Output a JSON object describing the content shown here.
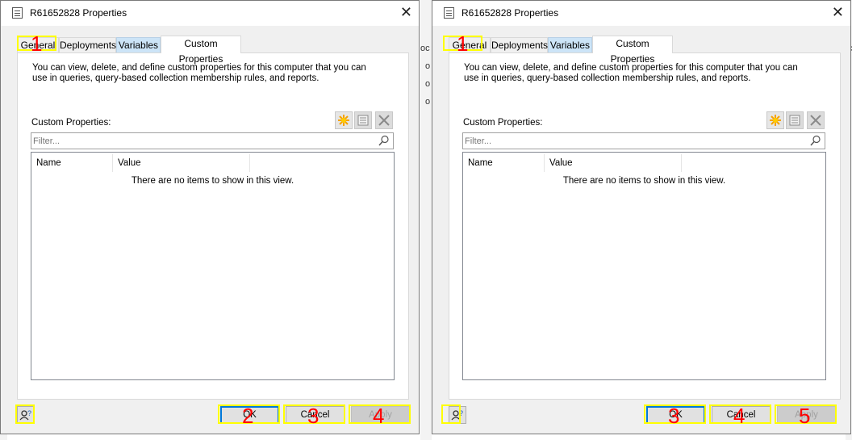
{
  "colors": {
    "annotation_box": "#ffff00",
    "annotation_number": "#ff0000",
    "tab_highlight": "#cce4f7",
    "default_button_border": "#0078d7"
  },
  "background": {
    "left_fragments": [
      "o",
      "o",
      "o"
    ],
    "mid_fragments": [
      "oc",
      "o",
      "o",
      "o"
    ],
    "right_fragments": [
      "oc",
      "o",
      "o"
    ]
  },
  "dialogs": [
    {
      "title": "R61652828 Properties",
      "close_glyph": "✕",
      "tabs": [
        "General",
        "Deployments",
        "Variables",
        "Custom Properties"
      ],
      "active_tab": "Custom Properties",
      "description": "You can view, delete, and define custom properties for this computer that you can use in queries, query-based collection membership rules, and reports.",
      "custom_properties_label": "Custom Properties:",
      "toolbar_icons": [
        "new-star-icon",
        "properties-icon",
        "delete-icon"
      ],
      "filter_placeholder": "Filter...",
      "columns": [
        "Name",
        "Value"
      ],
      "empty_message": "There are no items to show in this view.",
      "buttons": {
        "ok": "OK",
        "cancel": "Cancel",
        "apply": "Apply"
      },
      "annotation_numbers": {
        "general_tab": "1",
        "ok": "2",
        "cancel": "3",
        "apply": "4"
      }
    },
    {
      "title": "R61652828 Properties",
      "close_glyph": "✕",
      "tabs": [
        "General",
        "Deployments",
        "Variables",
        "Custom Properties"
      ],
      "active_tab": "Custom Properties",
      "description": "You can view, delete, and define custom properties for this computer that you can use in queries, query-based collection membership rules, and reports.",
      "custom_properties_label": "Custom Properties:",
      "toolbar_icons": [
        "new-star-icon",
        "properties-icon",
        "delete-icon"
      ],
      "filter_placeholder": "Filter...",
      "columns": [
        "Name",
        "Value"
      ],
      "empty_message": "There are no items to show in this view.",
      "buttons": {
        "ok": "OK",
        "cancel": "Cancel",
        "apply": "Apply"
      },
      "annotation_numbers": {
        "general_tab": "1",
        "ok": "3",
        "cancel": "4",
        "apply": "5"
      }
    }
  ]
}
